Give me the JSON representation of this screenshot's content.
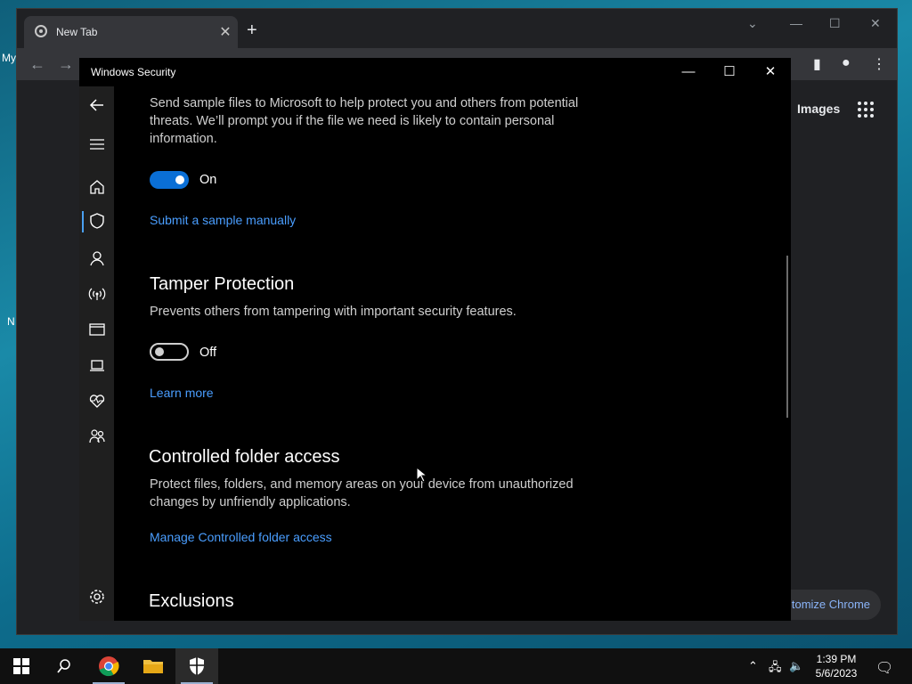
{
  "desktop": {
    "frag_top": "My",
    "frag_mid": "N"
  },
  "chrome": {
    "tab_title": "New Tab",
    "tab_close": "✕",
    "new_tab": "+",
    "images_link": "Images",
    "customize_label": "tomize Chrome"
  },
  "security": {
    "window_title": "Windows Security",
    "minimize": "—",
    "maximize": "☐",
    "close": "✕",
    "sample_desc": "Send sample files to Microsoft to help protect you and others from potential threats. We’ll prompt you if the file we need is likely to contain personal information.",
    "sample_toggle_label": "On",
    "sample_toggle_state": 1,
    "submit_link": "Submit a sample manually",
    "tamper_heading": "Tamper Protection",
    "tamper_desc": "Prevents others from tampering with important security features.",
    "tamper_toggle_label": "Off",
    "tamper_toggle_state": 0,
    "learn_more": "Learn more",
    "cfa_heading": "Controlled folder access",
    "cfa_desc": "Protect files, folders, and memory areas on your device from unauthorized changes by unfriendly applications.",
    "cfa_link": "Manage Controlled folder access",
    "exclusions_heading": "Exclusions",
    "sidebar_icons": [
      "back-arrow-icon",
      "hamburger-menu-icon",
      "home-icon",
      "shield-icon",
      "person-icon",
      "wireless-icon",
      "browser-window-icon",
      "laptop-icon",
      "heart-health-icon",
      "family-icon",
      "gear-icon"
    ]
  },
  "taskbar": {
    "time": "1:39 PM",
    "date": "5/6/2023"
  },
  "colors": {
    "accent": "#0a6fd6",
    "link": "#4a9eff"
  }
}
